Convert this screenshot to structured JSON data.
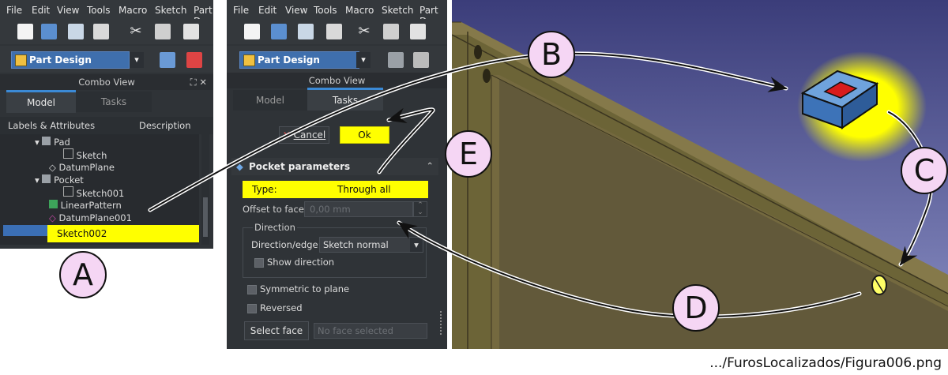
{
  "menu": [
    "File",
    "Edit",
    "View",
    "Tools",
    "Macro",
    "Sketch",
    "Part De"
  ],
  "workbench": "Part Design",
  "combo_view_title": "Combo View",
  "tabs": {
    "model": "Model",
    "tasks": "Tasks"
  },
  "tree": {
    "col_labels": "Labels & Attributes",
    "col_description": "Description",
    "items": [
      "Pad",
      "Sketch",
      "DatumPlane",
      "Pocket",
      "Sketch001",
      "LinearPattern",
      "DatumPlane001",
      "Sketch002"
    ]
  },
  "task": {
    "cancel": "Cancel",
    "ok": "Ok",
    "section_title": "Pocket parameters",
    "type_label": "Type:",
    "type_value": "Through all",
    "offset_label": "Offset to face",
    "offset_value": "0,00 mm",
    "direction_group": "Direction",
    "direction_edge_label": "Direction/edge:",
    "direction_edge_value": "Sketch normal",
    "show_direction": "Show direction",
    "symmetric": "Symmetric to plane",
    "reversed": "Reversed",
    "select_face": "Select face",
    "no_face": "No face selected"
  },
  "markers": [
    "A",
    "B",
    "C",
    "D",
    "E"
  ],
  "caption": ".../FurosLocalizados/Figura006.png",
  "colors": {
    "highlight": "#ffff00",
    "marker_fill": "#f5d6f4",
    "panel": "#2f3337",
    "accent": "#3b8ad6",
    "box_face": "#4a83c7"
  },
  "icons": [
    "new-document-icon",
    "open-icon",
    "save-icon",
    "print-icon",
    "cut-icon",
    "copy-icon",
    "paste-icon",
    "part-design-icon",
    "body-icon",
    "sketch-icon",
    "pocket-icon",
    "pad-icon",
    "datum-plane-icon",
    "linear-pattern-icon",
    "cancel-icon"
  ]
}
